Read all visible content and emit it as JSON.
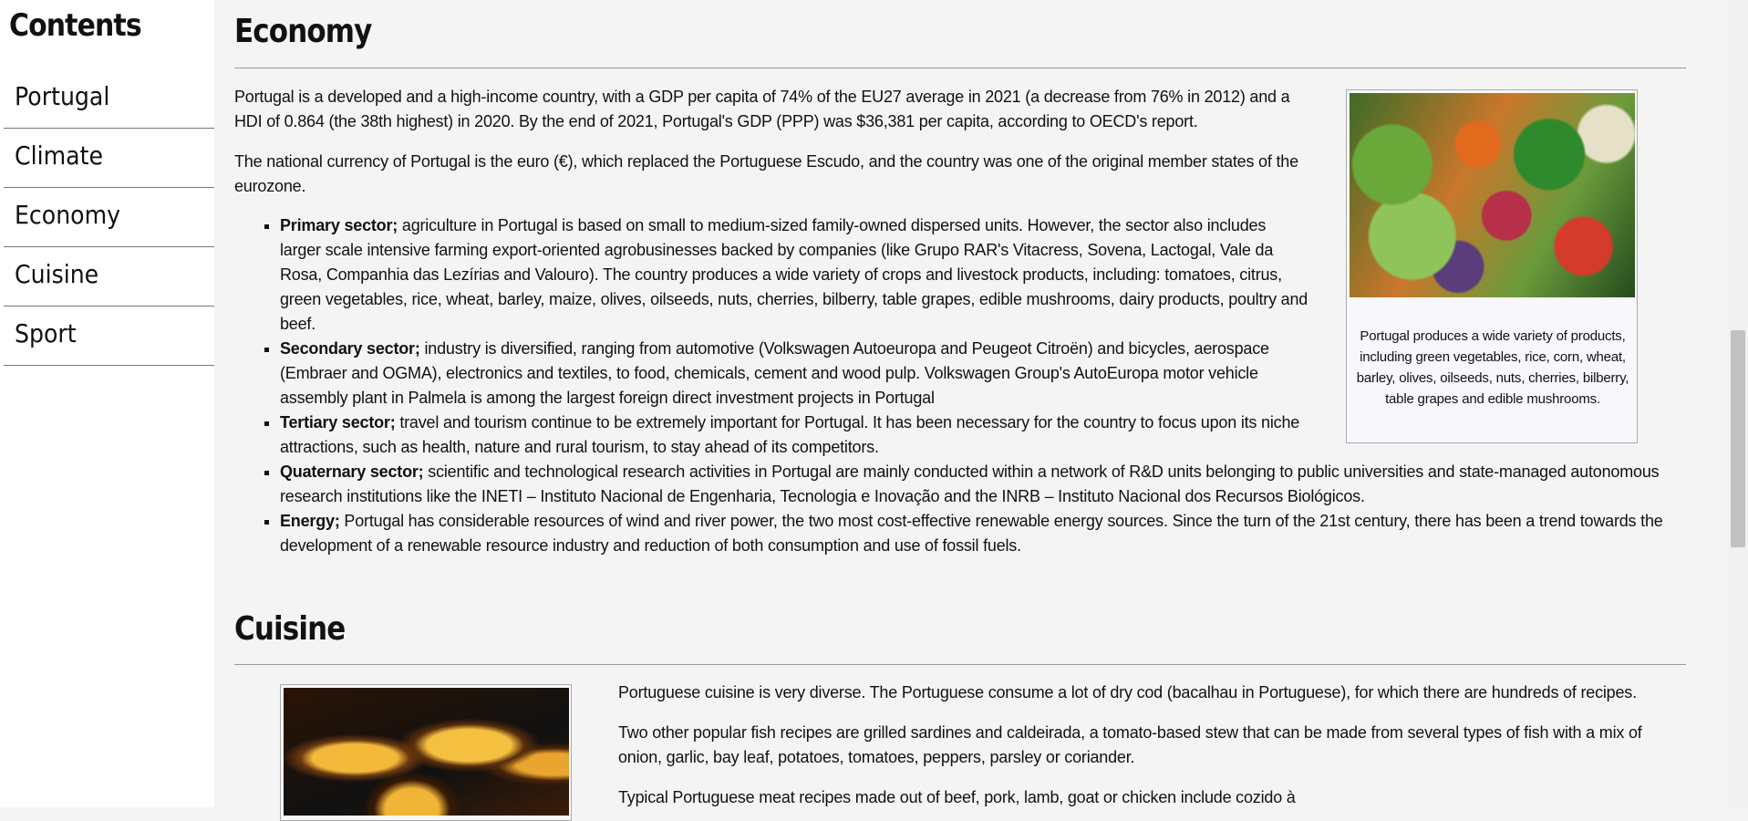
{
  "sidebar": {
    "title": "Contents",
    "items": [
      {
        "label": "Portugal"
      },
      {
        "label": "Climate"
      },
      {
        "label": "Economy"
      },
      {
        "label": "Cuisine"
      },
      {
        "label": "Sport"
      }
    ]
  },
  "economy": {
    "title": "Economy",
    "p1": "Portugal is a developed and a high-income country, with a GDP per capita of 74% of the EU27 average in 2021 (a decrease from 76% in 2012) and a HDI of 0.864 (the 38th highest) in 2020. By the end of 2021, Portugal's GDP (PPP) was $36,381 per capita, according to OECD's report.",
    "p2": "The national currency of Portugal is the euro (€), which replaced the Portuguese Escudo, and the country was one of the original member states of the eurozone.",
    "sectors": [
      {
        "name": "Primary sector;",
        "text": " agriculture in Portugal is based on small to medium-sized family-owned dispersed units. However, the sector also includes larger scale intensive farming export-oriented agrobusinesses backed by companies (like Grupo RAR's Vitacress, Sovena, Lactogal, Vale da Rosa, Companhia das Lezírias and Valouro). The country produces a wide variety of crops and livestock products, including: tomatoes, citrus, green vegetables, rice, wheat, barley, maize, olives, oilseeds, nuts, cherries, bilberry, table grapes, edible mushrooms, dairy products, poultry and beef."
      },
      {
        "name": "Secondary sector;",
        "text": " industry is diversified, ranging from automotive (Volkswagen Autoeuropa and Peugeot Citroën) and bicycles, aerospace (Embraer and OGMA), electronics and textiles, to food, chemicals, cement and wood pulp. Volkswagen Group's AutoEuropa motor vehicle assembly plant in Palmela is among the largest foreign direct investment projects in Portugal"
      },
      {
        "name": "Tertiary sector;",
        "text": " travel and tourism continue to be extremely important for Portugal. It has been necessary for the country to focus upon its niche attractions, such as health, nature and rural tourism, to stay ahead of its competitors."
      },
      {
        "name": "Quaternary sector;",
        "text": " scientific and technological research activities in Portugal are mainly conducted within a network of R&D units belonging to public universities and state-managed autonomous research institutions like the INETI – Instituto Nacional de Engenharia, Tecnologia e Inovação and the INRB – Instituto Nacional dos Recursos Biológicos."
      },
      {
        "name": "Energy;",
        "text": " Portugal has considerable resources of wind and river power, the two most cost-effective renewable energy sources. Since the turn of the 21st century, there has been a trend towards the development of a renewable resource industry and reduction of both consumption and use of fossil fuels."
      }
    ],
    "figure_caption": "Portugal produces a wide variety of products, including green vegetables, rice, corn, wheat, barley, olives, oilseeds, nuts, cherries, bilberry, table grapes and edible mushrooms."
  },
  "cuisine": {
    "title": "Cuisine",
    "p1": "Portuguese cuisine is very diverse. The Portuguese consume a lot of dry cod (bacalhau in Portuguese), for which there are hundreds of recipes.",
    "p2": "Two other popular fish recipes are grilled sardines and caldeirada, a tomato-based stew that can be made from several types of fish with a mix of onion, garlic, bay leaf, potatoes, tomatoes, peppers, parsley or coriander.",
    "p3": "Typical Portuguese meat recipes made out of beef, pork, lamb, goat or chicken include cozido à"
  }
}
